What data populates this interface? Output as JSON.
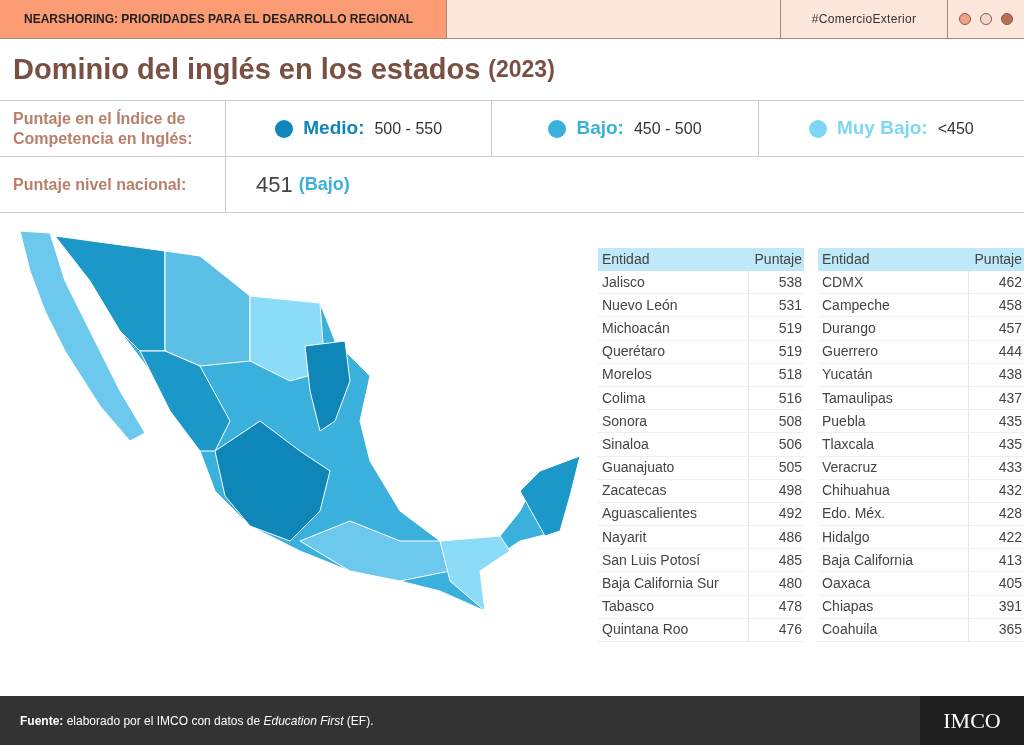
{
  "header": {
    "section": "NEARSHORING: PRIORIDADES PARA EL DESARROLLO REGIONAL",
    "hashtag": "#ComercioExterior"
  },
  "title": {
    "main": "Dominio del inglés en los estados",
    "year": "(2023)"
  },
  "legend": {
    "label": "Puntaje en el Índice de Competencia en Inglés:",
    "items": [
      {
        "name": "Medio:",
        "range": "500 - 550",
        "color": "#0e86b8"
      },
      {
        "name": "Bajo:",
        "range": "450 - 500",
        "color": "#3ab0dc"
      },
      {
        "name": "Muy Bajo:",
        "range": "<450",
        "color": "#7dd6f5"
      }
    ]
  },
  "national": {
    "label": "Puntaje nivel nacional:",
    "score": "451",
    "level": "(Bajo)"
  },
  "tables": [
    {
      "columns": [
        "Entidad",
        "Puntaje"
      ],
      "rows": [
        [
          "Jalisco",
          "538"
        ],
        [
          "Nuevo León",
          "531"
        ],
        [
          "Michoacán",
          "519"
        ],
        [
          "Querétaro",
          "519"
        ],
        [
          "Morelos",
          "518"
        ],
        [
          "Colima",
          "516"
        ],
        [
          "Sonora",
          "508"
        ],
        [
          "Sinaloa",
          "506"
        ],
        [
          "Guanajuato",
          "505"
        ],
        [
          "Zacatecas",
          "498"
        ],
        [
          "Aguascalientes",
          "492"
        ],
        [
          "Nayarit",
          "486"
        ],
        [
          "San Luis Potosí",
          "485"
        ],
        [
          "Baja California Sur",
          "480"
        ],
        [
          "Tabasco",
          "478"
        ],
        [
          "Quintana Roo",
          "476"
        ]
      ]
    },
    {
      "columns": [
        "Entidad",
        "Puntaje"
      ],
      "rows": [
        [
          "CDMX",
          "462"
        ],
        [
          "Campeche",
          "458"
        ],
        [
          "Durango",
          "457"
        ],
        [
          "Guerrero",
          "444"
        ],
        [
          "Yucatán",
          "438"
        ],
        [
          "Tamaulipas",
          "437"
        ],
        [
          "Puebla",
          "435"
        ],
        [
          "Tlaxcala",
          "435"
        ],
        [
          "Veracruz",
          "433"
        ],
        [
          "Chihuahua",
          "432"
        ],
        [
          "Edo. Méx.",
          "428"
        ],
        [
          "Hidalgo",
          "422"
        ],
        [
          "Baja California",
          "413"
        ],
        [
          "Oaxaca",
          "405"
        ],
        [
          "Chiapas",
          "391"
        ],
        [
          "Coahuila",
          "365"
        ]
      ]
    }
  ],
  "footer": {
    "source": "**Fuente:** elaborado por el IMCO con datos de *Education First* (EF).",
    "logo": "IMCO"
  }
}
